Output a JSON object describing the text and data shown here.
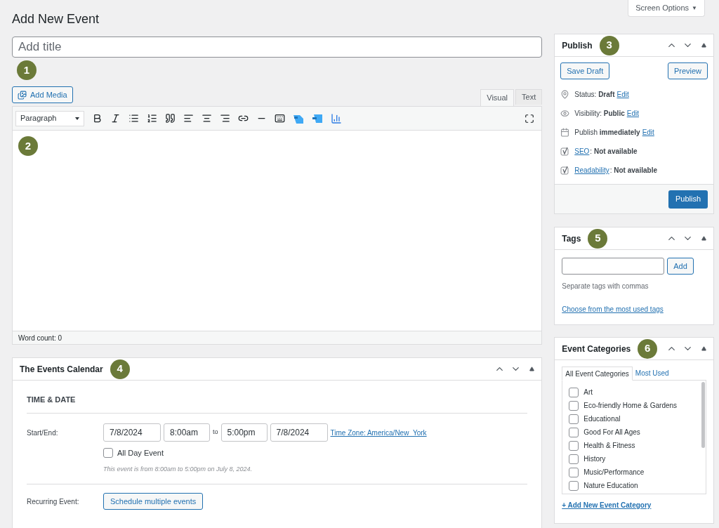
{
  "screen_options": {
    "label": "Screen Options",
    "caret": "▼"
  },
  "page_title": "Add New Event",
  "title_field": {
    "placeholder": "Add title"
  },
  "markers": [
    "1",
    "2",
    "3",
    "4",
    "5",
    "6"
  ],
  "add_media": "Add Media",
  "editor_tabs": [
    {
      "label": "Visual",
      "selected": true
    },
    {
      "label": "Text",
      "selected": false
    }
  ],
  "format_select": {
    "value": "Paragraph"
  },
  "word_count": "Word count: 0",
  "events_calendar": {
    "title": "The Events Calendar",
    "section": "TIME & DATE",
    "start_end_label": "Start/End:",
    "start_date": "7/8/2024",
    "start_time": "8:00am",
    "to": "to",
    "end_time": "5:00pm",
    "end_date": "7/8/2024",
    "timezone": "Time Zone: America/New_York",
    "all_day": {
      "label": "All Day Event",
      "checked": false
    },
    "summary": "This event is from 8:00am to 5:00pm on July 8, 2024.",
    "recurring_label": "Recurring Event:",
    "recurring_button": "Schedule multiple events"
  },
  "publish": {
    "title": "Publish",
    "save_draft": "Save Draft",
    "preview": "Preview",
    "rows": [
      {
        "kind": "pin",
        "text": "Status: **Draft**",
        "link": "Edit"
      },
      {
        "kind": "eye",
        "text": "Visibility: **Public**",
        "link": "Edit"
      },
      {
        "kind": "calendar",
        "text": "Publish **immediately**",
        "link": "Edit"
      },
      {
        "kind": "yoast",
        "link": "SEO",
        "text": ": **Not available**"
      },
      {
        "kind": "yoast",
        "link": "Readability",
        "text": ": **Not available**"
      }
    ],
    "publish_button": "Publish"
  },
  "tags": {
    "title": "Tags",
    "add": "Add",
    "hint": "Separate tags with commas",
    "link": "Choose from the most used tags"
  },
  "event_categories": {
    "title": "Event Categories",
    "tabs": [
      {
        "label": "All Event Categories",
        "selected": true
      },
      {
        "label": "Most Used",
        "selected": false
      }
    ],
    "items": [
      {
        "label": "Art",
        "checked": false
      },
      {
        "label": "Eco-friendly Home & Gardens",
        "checked": false
      },
      {
        "label": "Educational",
        "checked": false
      },
      {
        "label": "Good For All Ages",
        "checked": false
      },
      {
        "label": "Health & Fitness",
        "checked": false
      },
      {
        "label": "History",
        "checked": false
      },
      {
        "label": "Music/Performance",
        "checked": false
      },
      {
        "label": "Nature Education",
        "checked": false
      }
    ],
    "add_link": "+ Add New Event Category"
  }
}
